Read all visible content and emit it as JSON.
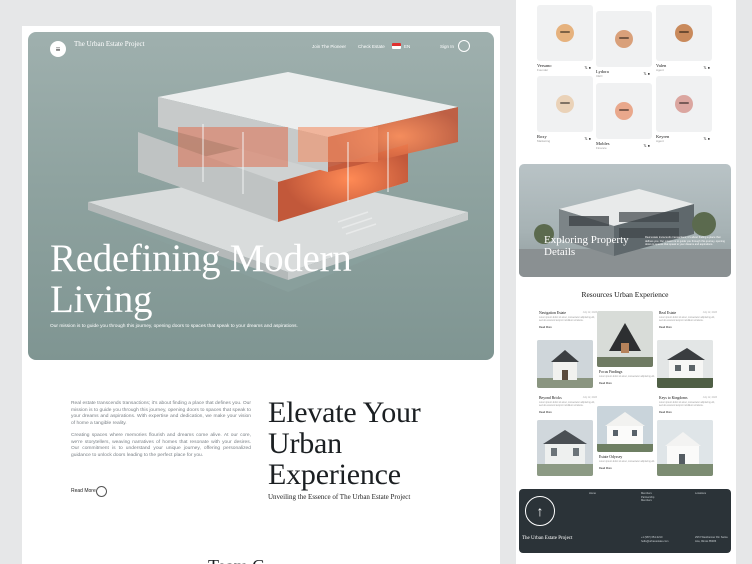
{
  "hero": {
    "logo": "The Urban Estate Project",
    "nav": {
      "join": "Join The Pioneer",
      "check": "Check Estate",
      "lang": "EN",
      "signin": "Sign In"
    },
    "title": "Redefining Modern Living",
    "subtitle": "Our mission is to guide you through this journey, opening doors to spaces that speak to your dreams and aspirations."
  },
  "intro": {
    "p1": "Real estate transcends transactions; it's about finding a place that defines you. Our mission is to guide you through this journey, opening doors to spaces that speak to your dreams and aspirations. With expertise and dedication, we make your vision of home a tangible reality.",
    "p2": "Creating spaces where memories flourish and dreams come alive. At our core, we're storytellers, weaving narratives of homes that resonate with your desires. Our commitment is to understand your unique journey, offering personalized guidance to unlock doors leading to the perfect place for you.",
    "read_more": "Read More"
  },
  "elevate": {
    "title": "Elevate Your Urban Experience",
    "subtitle": "Unveiling the Essence of The Urban Estate Project"
  },
  "team_heading_partial": "Team C",
  "team": [
    {
      "name": "Versano",
      "role": "Founder",
      "avatar_color": "#e6b27e"
    },
    {
      "name": "Lydora",
      "role": "CEO",
      "avatar_color": "#d9a07a"
    },
    {
      "name": "Valen",
      "role": "Agent",
      "avatar_color": "#c98a5c"
    },
    {
      "name": "Roxy",
      "role": "Marketing",
      "avatar_color": "#ead2b8"
    },
    {
      "name": "Mobles",
      "role": "Finance",
      "avatar_color": "#e9a88c"
    },
    {
      "name": "Keyren",
      "role": "Agent",
      "avatar_color": "#dba6a0"
    }
  ],
  "explore": {
    "title": "Exploring Property Details",
    "text": "Real estate transcends transactions; it's about finding a place that defines you. Our mission is to guide you through this journey, opening doors to spaces that speak to your dreams and aspirations."
  },
  "resources": {
    "title": "Resources Urban Experience",
    "cards": [
      {
        "title": "Navigation Estate",
        "date": "July 12, 2023",
        "text": "Lorem ipsum dolor sit amet, consectetur adipiscing elit, sed do eiusmod tempor incididunt ut labore.",
        "more": "Read More"
      },
      {
        "title": "Real Estate",
        "date": "July 12, 2023",
        "text": "Lorem ipsum dolor sit amet, consectetur adipiscing elit, sed do eiusmod tempor incididunt ut labore.",
        "more": "Read More"
      },
      {
        "title": "Focus Findings",
        "date": "",
        "text": "Lorem ipsum dolor sit amet, consectetur adipiscing elit.",
        "more": "Read More"
      },
      {
        "title": "Beyond Bricks",
        "date": "July 12, 2023",
        "text": "Lorem ipsum dolor sit amet, consectetur adipiscing elit, sed do eiusmod tempor incididunt ut labore.",
        "more": "Read More"
      },
      {
        "title": "Keys to Kingdoms",
        "date": "July 12, 2023",
        "text": "Lorem ipsum dolor sit amet, consectetur adipiscing elit, sed do eiusmod tempor incididunt ut labore.",
        "more": "Read More"
      },
      {
        "title": "Estate Odyssey",
        "date": "",
        "text": "Lorem ipsum dolor sit amet, consectetur adipiscing elit.",
        "more": "Read More"
      }
    ]
  },
  "footer": {
    "logo": "The Urban Estate Project",
    "col1": [
      "Home"
    ],
    "col2": [
      "Members",
      "Partnership",
      "Members"
    ],
    "col3": [
      "Locations"
    ],
    "phone": "+1 (987) 654-3210",
    "email": "hello@urbanestate.com",
    "address": "2972 Westheimer Rd. Santa Ana, Illinois 85486"
  },
  "colors": {
    "hero_bg": "#8fa3a0",
    "accent_glow": "#f07a4a",
    "footer_bg": "#2b3338"
  }
}
